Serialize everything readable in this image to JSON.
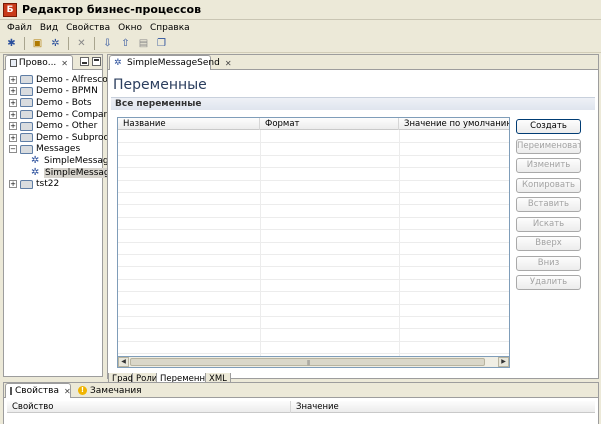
{
  "window": {
    "title": "Редактор бизнес-процессов",
    "app_icon": "app-logo-icon"
  },
  "menu": [
    "Файл",
    "Вид",
    "Свойства",
    "Окно",
    "Справка"
  ],
  "toolbar": {
    "icons": [
      "new-process-icon",
      "open-icon",
      "settings-icon",
      "delete-icon",
      "import-icon",
      "export-icon",
      "save-icon",
      "copy-icon"
    ]
  },
  "explorer": {
    "tab_label": "Прово...",
    "tab_close": "✕",
    "tree": [
      {
        "label": "Demo - Alfresco",
        "type": "folder",
        "level": 0,
        "expander": "+"
      },
      {
        "label": "Demo - BPMN",
        "type": "folder",
        "level": 0,
        "expander": "+"
      },
      {
        "label": "Demo - Bots",
        "type": "folder",
        "level": 0,
        "expander": "+"
      },
      {
        "label": "Demo - Company",
        "type": "folder",
        "level": 0,
        "expander": "+"
      },
      {
        "label": "Demo - Other",
        "type": "folder",
        "level": 0,
        "expander": "+"
      },
      {
        "label": "Demo - Subprocess",
        "type": "folder",
        "level": 0,
        "expander": "+"
      },
      {
        "label": "Messages",
        "type": "folder",
        "level": 0,
        "expander": "−"
      },
      {
        "label": "SimpleMessage",
        "type": "process",
        "level": 1,
        "expander": ""
      },
      {
        "label": "SimpleMessage",
        "type": "process",
        "level": 1,
        "expander": "",
        "selected": true
      },
      {
        "label": "tst22",
        "type": "folder",
        "level": 0,
        "expander": "+"
      }
    ]
  },
  "editor": {
    "tab_label": "SimpleMessageSend",
    "tab_close": "✕",
    "page_title": "Переменные",
    "section_title": "Все переменные",
    "columns": [
      "Название",
      "Формат",
      "Значение по умолчанию"
    ],
    "rows": [],
    "buttons": [
      {
        "label": "Создать",
        "enabled": true
      },
      {
        "label": "Переименовать",
        "enabled": false
      },
      {
        "label": "Изменить",
        "enabled": false
      },
      {
        "label": "Копировать",
        "enabled": false
      },
      {
        "label": "Вставить",
        "enabled": false
      },
      {
        "label": "Искать",
        "enabled": false
      },
      {
        "label": "Вверх",
        "enabled": false
      },
      {
        "label": "Вниз",
        "enabled": false
      },
      {
        "label": "Удалить",
        "enabled": false
      }
    ],
    "bottom_tabs": [
      {
        "label": "Граф",
        "active": false
      },
      {
        "label": "Роли",
        "active": false
      },
      {
        "label": "Переменные",
        "active": true
      },
      {
        "label": "XML",
        "active": false
      }
    ],
    "scroll_grip": "|||"
  },
  "properties": {
    "tabs": [
      {
        "label": "Свойства",
        "active": true,
        "icon": "properties-icon",
        "close": "✕"
      },
      {
        "label": "Замечания",
        "active": false,
        "icon": "warning-icon"
      }
    ],
    "columns": [
      "Свойство",
      "Значение"
    ]
  }
}
